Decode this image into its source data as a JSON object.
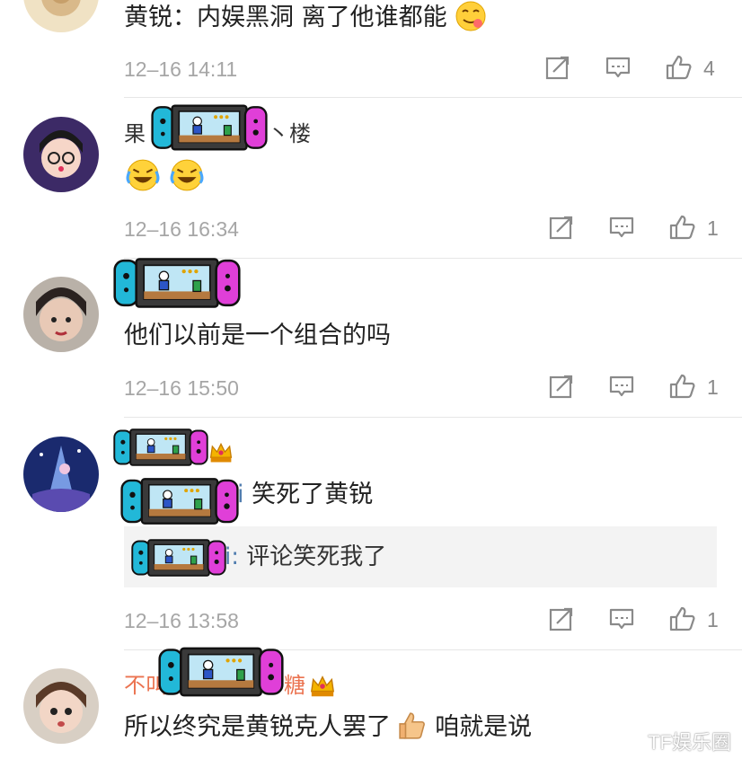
{
  "comments": [
    {
      "text": "黄锐：内娱黑洞 离了他谁都能",
      "time": "12–16 14:11",
      "likes": "4"
    },
    {
      "name_prefix": "果",
      "name_suffix": "丶楼",
      "time": "12–16 16:34",
      "likes": "1"
    },
    {
      "text": "他们以前是一个组合的吗",
      "time": "12–16 15:50",
      "likes": "1"
    },
    {
      "reply_prefix": "i",
      "text": "笑死了黄锐",
      "quote_prefix": "i:",
      "quote_text": "评论笑死我了",
      "time": "12–16 13:58",
      "likes": "1"
    },
    {
      "name_prefix": "不叫",
      "name_suffix": "糖",
      "text_before": "所以终究是黄锐克人罢了",
      "text_after": "咱就是说"
    }
  ],
  "icons": {
    "share": "share-icon",
    "comment": "comment-icon",
    "like": "thumbs-up-icon",
    "sticker": "game-console-sticker",
    "crown": "crown-badge-icon"
  },
  "colors": {
    "username": "#eb7350",
    "link": "#507daf",
    "meta": "#a6a6a6"
  },
  "watermark": "TF娱乐圈"
}
